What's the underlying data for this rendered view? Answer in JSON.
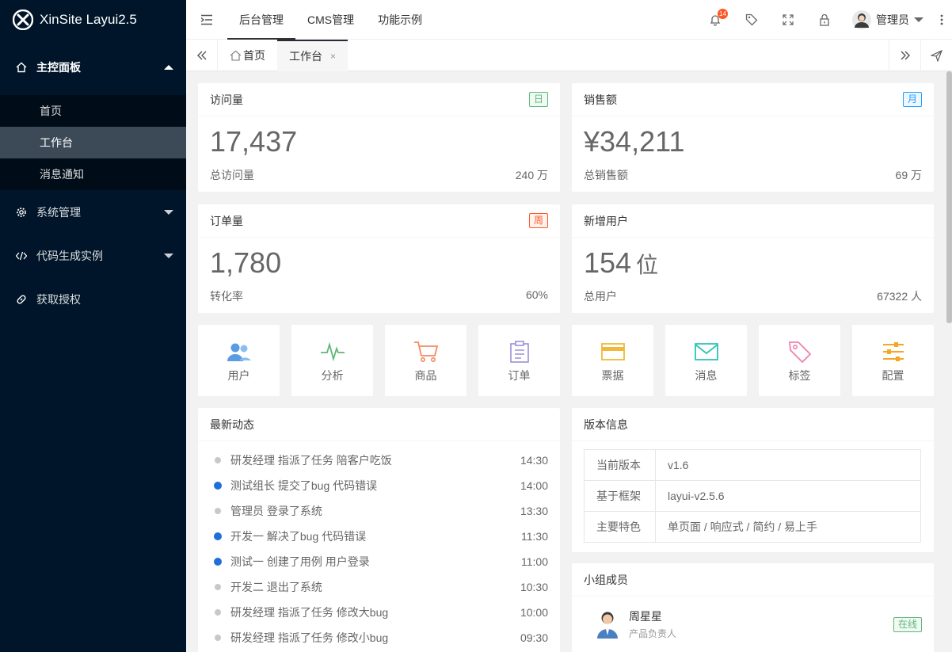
{
  "app": {
    "title": "XinSite Layui2.5"
  },
  "sidebar": {
    "groups": [
      {
        "label": "主控面板",
        "icon": "home-icon",
        "expanded": true,
        "items": [
          {
            "label": "首页"
          },
          {
            "label": "工作台",
            "active": true
          },
          {
            "label": "消息通知"
          }
        ]
      },
      {
        "label": "系统管理",
        "icon": "gear-icon"
      },
      {
        "label": "代码生成实例",
        "icon": "code-icon"
      },
      {
        "label": "获取授权",
        "icon": "link-icon"
      }
    ]
  },
  "topbar": {
    "nav": [
      "后台管理",
      "CMS管理",
      "功能示例"
    ],
    "notification_count": "14",
    "user": {
      "name": "管理员"
    }
  },
  "tabs": [
    {
      "label": "首页",
      "icon": "home-outline-icon"
    },
    {
      "label": "工作台",
      "active": true,
      "close": "×"
    }
  ],
  "stats": [
    {
      "title": "访问量",
      "tag": "日",
      "tag_color": "#5FB878",
      "value": "17,437",
      "foot_label": "总访问量",
      "foot_value": "240 万"
    },
    {
      "title": "销售额",
      "tag": "月",
      "tag_color": "#1E9FFF",
      "value": "¥34,211",
      "foot_label": "总销售额",
      "foot_value": "69 万"
    },
    {
      "title": "订单量",
      "tag": "周",
      "tag_color": "#FF5722",
      "value": "1,780",
      "foot_label": "转化率",
      "foot_value": "60%"
    },
    {
      "title": "新增用户",
      "value": "154",
      "unit": "位",
      "foot_label": "总用户",
      "foot_value": "67322 人"
    }
  ],
  "shortcuts": [
    {
      "label": "用户",
      "icon": "users-icon",
      "color": "#5A9BE6"
    },
    {
      "label": "分析",
      "icon": "pulse-icon",
      "color": "#5FB878"
    },
    {
      "label": "商品",
      "icon": "cart-icon",
      "color": "#F58A5E"
    },
    {
      "label": "订单",
      "icon": "clipboard-icon",
      "color": "#9A8FD9"
    },
    {
      "label": "票据",
      "icon": "card-icon",
      "color": "#F2B83B"
    },
    {
      "label": "消息",
      "icon": "mail-icon",
      "color": "#2EC4B6"
    },
    {
      "label": "标签",
      "icon": "tag-icon",
      "color": "#F07FB0"
    },
    {
      "label": "配置",
      "icon": "sliders-icon",
      "color": "#F5A623"
    }
  ],
  "activity": {
    "title": "最新动态",
    "items": [
      {
        "text": "研发经理 指派了任务 陪客户吃饭",
        "time": "14:30",
        "highlight": false
      },
      {
        "text": "测试组长 提交了bug 代码错误",
        "time": "14:00",
        "highlight": true
      },
      {
        "text": "管理员 登录了系统",
        "time": "13:30",
        "highlight": false
      },
      {
        "text": "开发一 解决了bug 代码错误",
        "time": "11:30",
        "highlight": true
      },
      {
        "text": "测试一 创建了用例 用户登录",
        "time": "11:00",
        "highlight": true
      },
      {
        "text": "开发二 退出了系统",
        "time": "10:30",
        "highlight": false
      },
      {
        "text": "研发经理 指派了任务 修改大bug",
        "time": "10:00",
        "highlight": false
      },
      {
        "text": "研发经理 指派了任务 修改小bug",
        "time": "09:30",
        "highlight": false
      }
    ]
  },
  "version": {
    "title": "版本信息",
    "rows": [
      {
        "key": "当前版本",
        "value": "v1.6"
      },
      {
        "key": "基于框架",
        "value": "layui-v2.5.6"
      },
      {
        "key": "主要特色",
        "value": "单页面 / 响应式 / 简约 / 易上手"
      }
    ]
  },
  "team": {
    "title": "小组成员",
    "members": [
      {
        "name": "周星星",
        "role": "产品负责人",
        "status": "在线"
      }
    ]
  }
}
